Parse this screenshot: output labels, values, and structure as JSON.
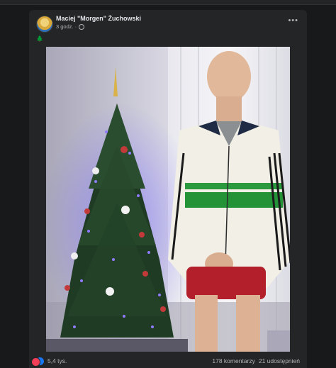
{
  "post": {
    "author": "Maciej \"Morgen\" Żuchowski",
    "time": "3 godz.",
    "separator": "·",
    "more_label": "•••",
    "text_emoji": "🌲"
  },
  "footer": {
    "reaction_count": "5,4 tys.",
    "comments": "178 komentarzy",
    "shares": "21 udostępnień"
  },
  "colors": {
    "background": "#18191a",
    "card": "#242526",
    "like": "#1877f2",
    "love": "#f33e58"
  },
  "icons": [
    "globe-icon",
    "more-options-icon",
    "like-reaction-icon",
    "love-reaction-icon"
  ]
}
